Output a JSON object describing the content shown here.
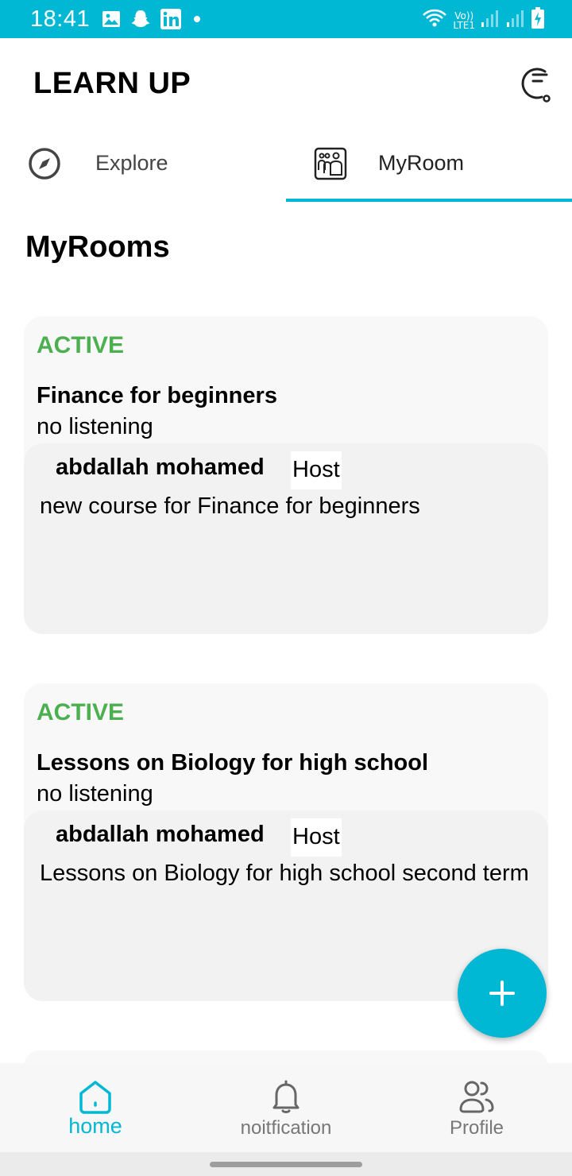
{
  "status_bar": {
    "time": "18:41",
    "network_label_top": "Vo))",
    "network_label_bottom": "LTE1",
    "background_color": "#00b8d4",
    "left_icons": [
      "gallery-icon",
      "snapchat-icon",
      "linkedin-icon",
      "dot-icon"
    ],
    "right_icons": [
      "wifi-icon",
      "signal-icon",
      "signal-icon",
      "battery-icon"
    ]
  },
  "app_bar": {
    "title": "LEARN UP",
    "history_icon": "history-clock-icon"
  },
  "tabs": [
    {
      "label": "Explore",
      "icon": "compass-icon",
      "selected": false
    },
    {
      "label": "MyRoom",
      "icon": "room-icon",
      "selected": true
    }
  ],
  "section_title": "MyRooms",
  "rooms": [
    {
      "status": "ACTIVE",
      "title": "Finance for beginners",
      "listening": "no listening",
      "host_name": "abdallah mohamed",
      "host_role": "Host",
      "description": "new course for Finance for beginners"
    },
    {
      "status": "ACTIVE",
      "title": "Lessons on Biology for high school",
      "listening": "no listening",
      "host_name": "abdallah mohamed",
      "host_role": "Host",
      "description": "Lessons on Biology for high school second term"
    }
  ],
  "fab": {
    "icon": "plus-icon"
  },
  "bottom_nav": [
    {
      "label": "home",
      "icon": "home-icon",
      "selected": true
    },
    {
      "label": "noitfication",
      "icon": "bell-icon",
      "selected": false
    },
    {
      "label": "Profile",
      "icon": "users-icon",
      "selected": false
    }
  ],
  "colors": {
    "accent": "#00b8d4",
    "active_status": "#4caf50"
  }
}
